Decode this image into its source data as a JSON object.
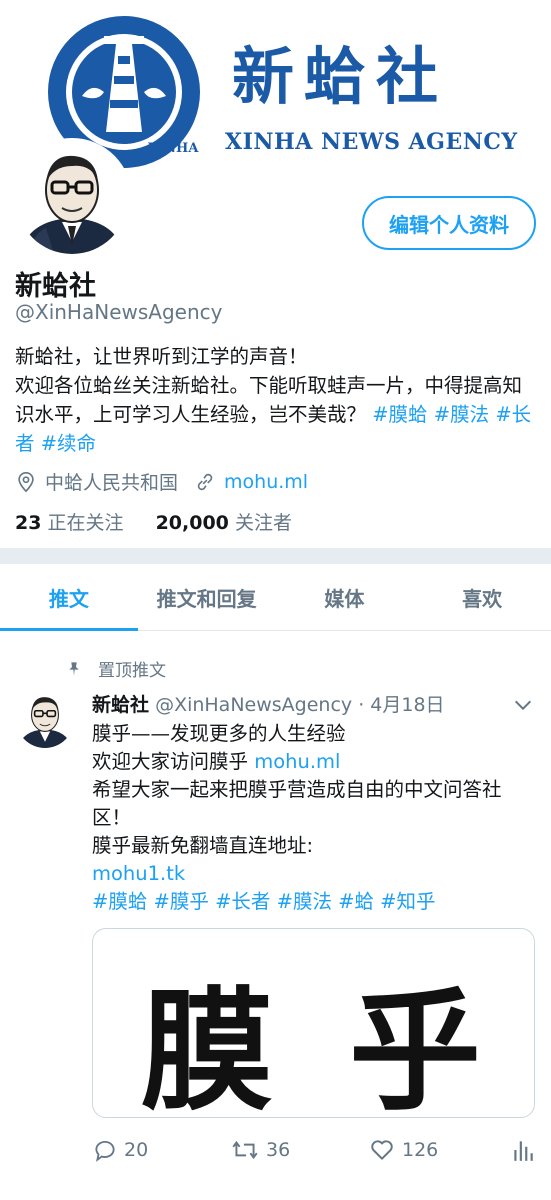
{
  "banner": {
    "title": "新蛤社",
    "subtitle": "XINHA NEWS AGENCY",
    "seal_text": "XINHA"
  },
  "profile": {
    "edit_button": "编辑个人资料",
    "name": "新蛤社",
    "handle": "@XinHaNewsAgency",
    "bio_line1": "新蛤社，让世界听到江学的声音！",
    "bio_line2": "欢迎各位蛤丝关注新蛤社。下能听取蛙声一片，中得提高知识水平，上可学习人生经验，岂不美哉？",
    "bio_tags": [
      "#膜蛤",
      "#膜法",
      "#长者",
      "#续命"
    ],
    "location": "中蛤人民共和国",
    "website": "mohu.ml",
    "following_count": "23",
    "following_label": "正在关注",
    "followers_count": "20,000",
    "followers_label": "关注者"
  },
  "tabs": [
    {
      "label": "推文",
      "active": true
    },
    {
      "label": "推文和回复",
      "active": false
    },
    {
      "label": "媒体",
      "active": false
    },
    {
      "label": "喜欢",
      "active": false
    }
  ],
  "pinned_tweet": {
    "pinned_label": "置顶推文",
    "author_name": "新蛤社",
    "author_handle": "@XinHaNewsAgency",
    "separator": "·",
    "date": "4月18日",
    "line1": "膜乎——发现更多的人生经验",
    "line2_prefix": "欢迎大家访问膜乎 ",
    "line2_link": "mohu.ml",
    "line3": "希望大家一起来把膜乎营造成自由的中文问答社区！",
    "line4": "膜乎最新免翻墙直连地址:",
    "line5_link": "mohu1.tk",
    "tags": "#膜蛤 #膜乎 #长者 #膜法 #蛤 #知乎",
    "card_char1": "膜",
    "card_char2": "乎",
    "replies": "20",
    "retweets": "36",
    "likes": "126"
  },
  "icons": {
    "location": "location-pin-icon",
    "link": "link-icon",
    "pin": "pin-icon",
    "chevron": "chevron-down-icon",
    "reply": "reply-icon",
    "retweet": "retweet-icon",
    "like": "heart-icon",
    "analytics": "analytics-icon"
  },
  "colors": {
    "accent": "#1da1f2",
    "brand": "#1a5aa6",
    "muted": "#657786",
    "text": "#14171a"
  }
}
